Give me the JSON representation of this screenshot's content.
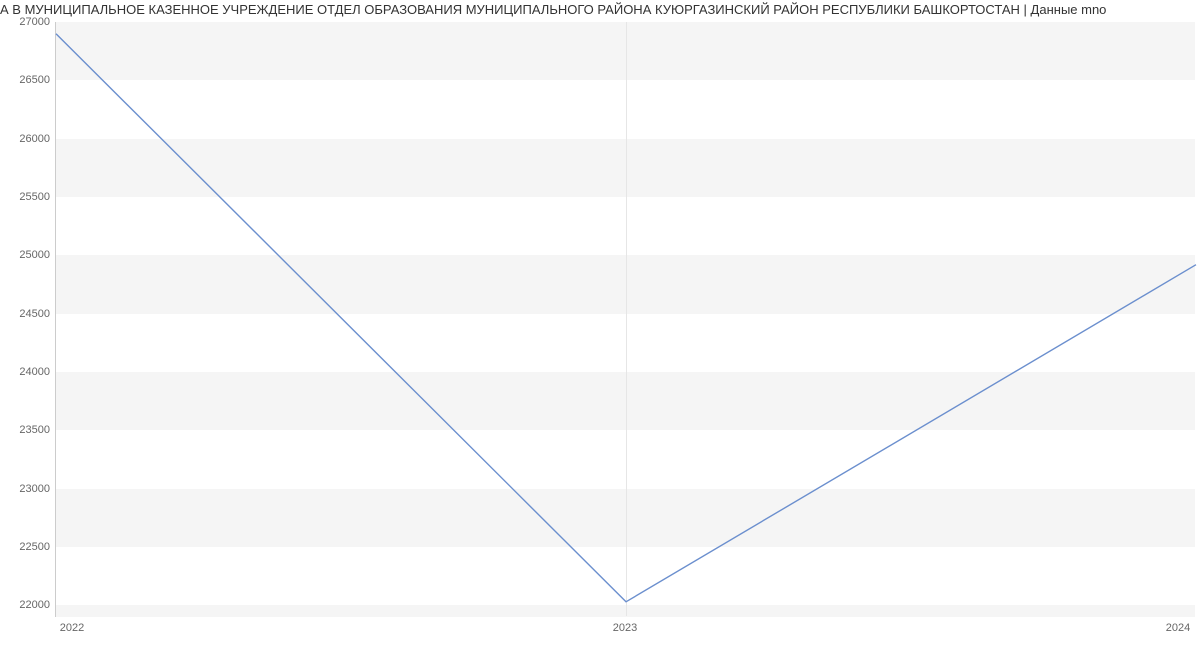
{
  "chart_data": {
    "type": "line",
    "title": "А В МУНИЦИПАЛЬНОЕ КАЗЕННОЕ УЧРЕЖДЕНИЕ ОТДЕЛ ОБРАЗОВАНИЯ МУНИЦИПАЛЬНОГО РАЙОНА КУЮРГАЗИНСКИЙ РАЙОН РЕСПУБЛИКИ БАШКОРТОСТАН | Данные mnо",
    "xlabel": "",
    "ylabel": "",
    "x": [
      "2022",
      "2023",
      "2024"
    ],
    "values": [
      27000,
      22130,
      25020
    ],
    "ylim": [
      22000,
      27100
    ],
    "y_ticks": [
      22000,
      22500,
      23000,
      23500,
      24000,
      24500,
      25000,
      25500,
      26000,
      26500,
      27000
    ],
    "x_ticks": [
      "2022",
      "2023",
      "2024"
    ],
    "line_color": "#6b8fce",
    "band_color": "#f5f5f5"
  }
}
